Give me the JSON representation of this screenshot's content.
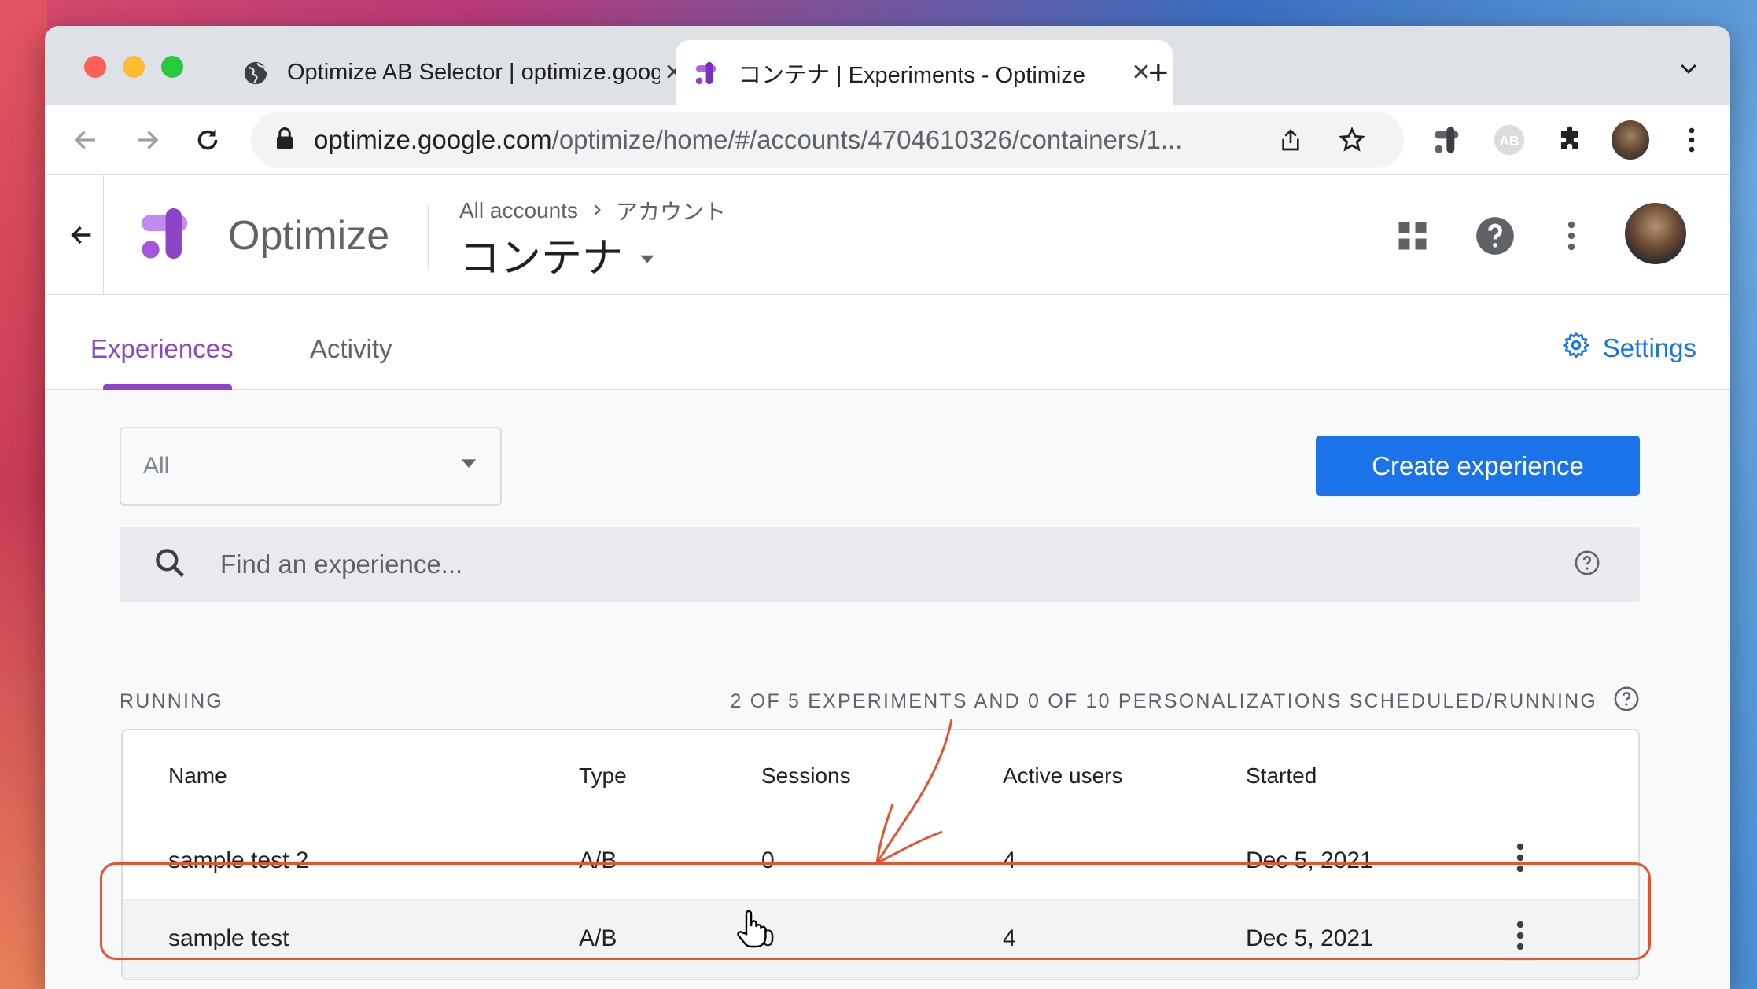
{
  "browser": {
    "tabs": [
      {
        "title": "Optimize AB Selector | optimize.google",
        "icon": "globe-icon",
        "active": false
      },
      {
        "title": "コンテナ | Experiments - Optimize",
        "icon": "optimize-logo-icon",
        "active": true
      }
    ],
    "url_host": "optimize.google.com",
    "url_path": "/optimize/home/#/accounts/4704610326/containers/1..."
  },
  "app": {
    "name": "Optimize",
    "breadcrumb_root": "All accounts",
    "breadcrumb_account": "アカウント",
    "container_name": "コンテナ"
  },
  "nav": {
    "tabs": [
      {
        "label": "Experiences",
        "active": true
      },
      {
        "label": "Activity",
        "active": false
      }
    ],
    "settings_label": "Settings"
  },
  "toolbar": {
    "filter_value": "All",
    "create_label": "Create experience",
    "search_placeholder": "Find an experience..."
  },
  "section": {
    "title": "RUNNING",
    "summary": "2 OF 5 EXPERIMENTS AND 0 OF 10 PERSONALIZATIONS SCHEDULED/RUNNING"
  },
  "table": {
    "columns": [
      "Name",
      "Type",
      "Sessions",
      "Active users",
      "Started"
    ],
    "rows": [
      {
        "name": "sample test 2",
        "type": "A/B",
        "sessions": "0",
        "active_users": "4",
        "started": "Dec 5, 2021"
      },
      {
        "name": "sample test",
        "type": "A/B",
        "sessions": "0",
        "active_users": "4",
        "started": "Dec 5, 2021"
      }
    ]
  },
  "colors": {
    "accent": "#8e44c7",
    "primary": "#1a73e8",
    "annotation": "#e5532f"
  }
}
